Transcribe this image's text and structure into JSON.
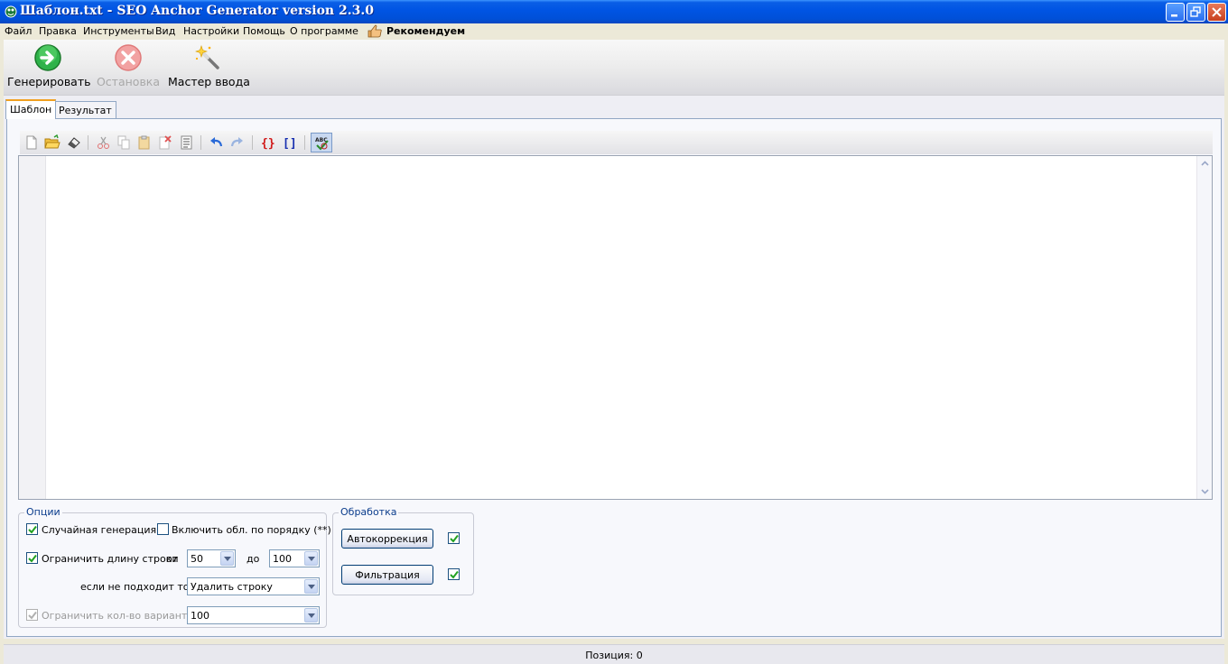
{
  "window": {
    "title": "Шаблон.txt - SEO Anchor Generator version 2.3.0"
  },
  "menu": {
    "items": [
      "Файл",
      "Правка",
      "Инструменты",
      "Вид",
      "Настройки",
      "Помощь",
      "О программе"
    ],
    "recommend": "Рекомендуем"
  },
  "toolbar": {
    "generate": "Генерировать",
    "stop": "Остановка",
    "wizard": "Мастер ввода"
  },
  "tabs": {
    "template": "Шаблон",
    "result": "Результат"
  },
  "editor": {
    "content": ""
  },
  "options": {
    "legend": "Опции",
    "random_generation": "Случайная генерация",
    "random_generation_checked": true,
    "include_in_order": "Включить обл. по порядку (**)",
    "include_in_order_checked": false,
    "limit_length": "Ограничить длину строки",
    "limit_length_checked": true,
    "from_label": "от",
    "from_value": "50",
    "to_label": "до",
    "to_value": "100",
    "if_not_fit": "если не подходит то",
    "if_not_fit_value": "Удалить строку",
    "limit_variants": "Ограничить кол-во вариантов",
    "limit_variants_checked": true,
    "limit_variants_value": "100"
  },
  "processing": {
    "legend": "Обработка",
    "autocorrect": "Автокоррекция",
    "autocorrect_checked": true,
    "filter": "Фильтрация",
    "filter_checked": true
  },
  "status": {
    "position": "Позиция: 0"
  },
  "colors": {
    "titlebar": "#0054e3",
    "accent_tab": "#f0a020",
    "legend_text": "#0a3c8c"
  }
}
